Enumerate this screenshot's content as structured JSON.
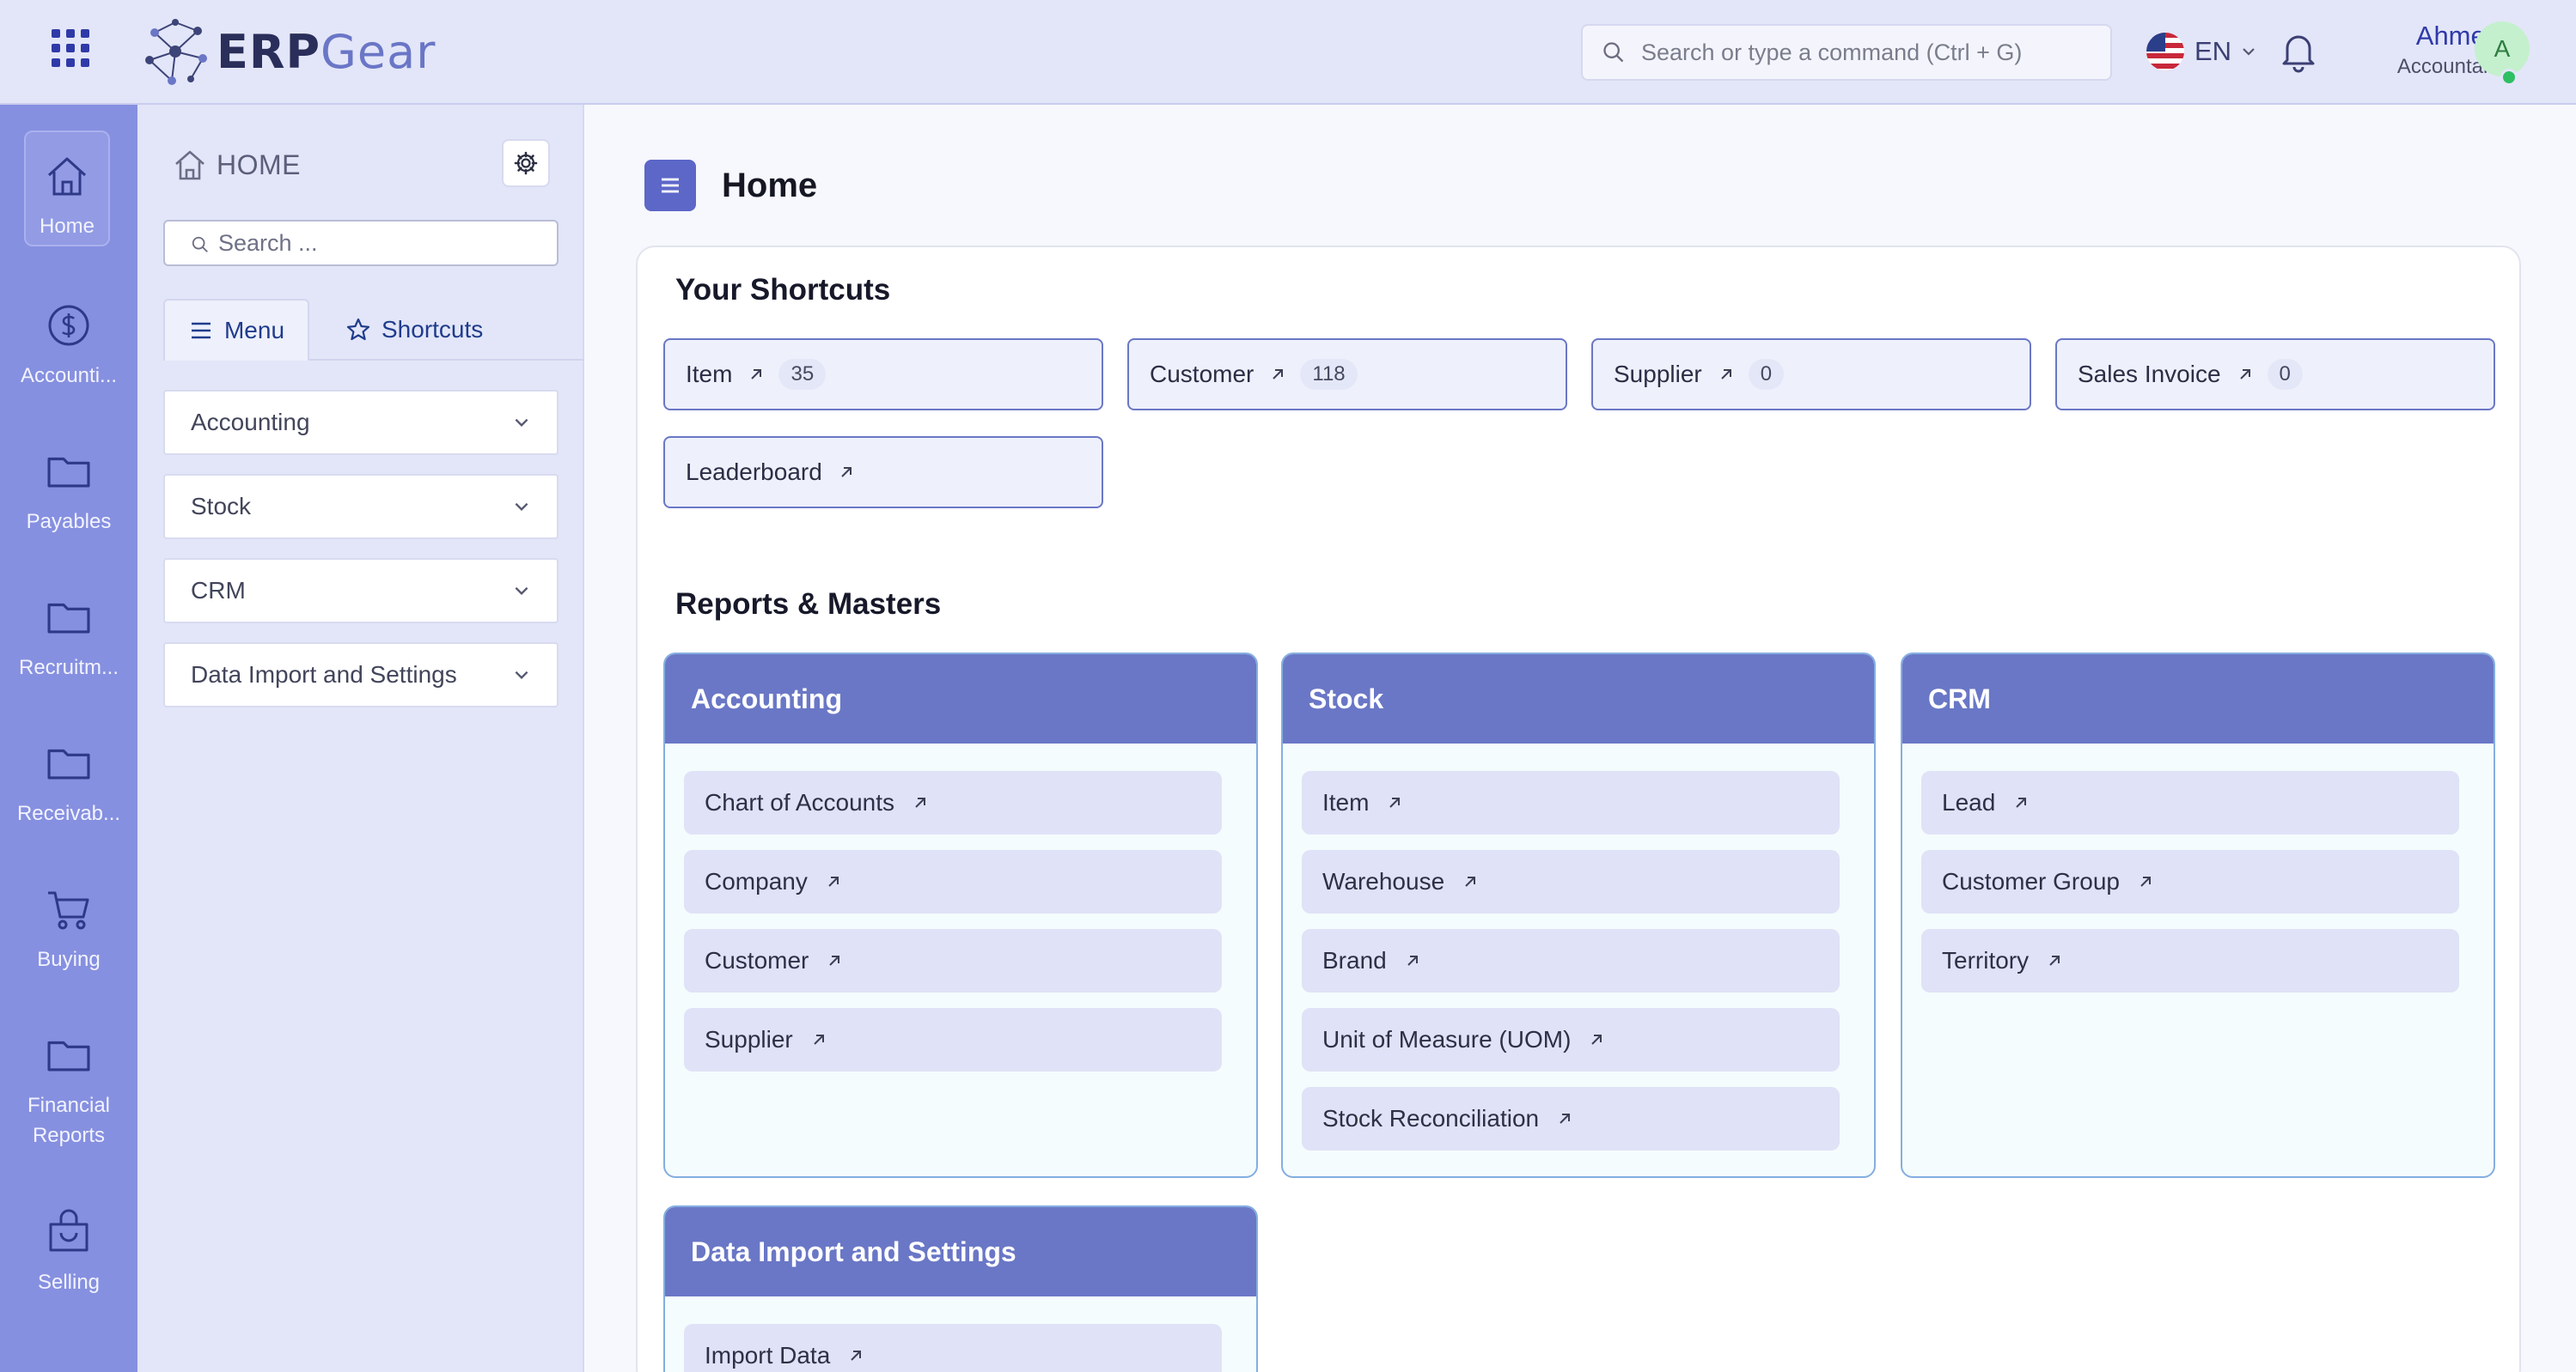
{
  "header": {
    "logo_primary": "ERP",
    "logo_secondary": "Gear",
    "search_placeholder": "Search or type a command (Ctrl + G)",
    "language": "EN",
    "user_name": "Ahmed",
    "user_role": "Accountant",
    "avatar_initial": "A"
  },
  "rail": {
    "items": [
      {
        "label": "Home",
        "icon": "home-icon"
      },
      {
        "label": "Accounti...",
        "icon": "dollar-circle-icon"
      },
      {
        "label": "Payables",
        "icon": "folder-icon"
      },
      {
        "label": "Recruitm...",
        "icon": "folder-icon"
      },
      {
        "label": "Receivab...",
        "icon": "folder-icon"
      },
      {
        "label": "Buying",
        "icon": "cart-icon"
      },
      {
        "label": "Financial Reports",
        "icon": "folder-icon"
      },
      {
        "label": "Selling",
        "icon": "shopping-bag-icon"
      }
    ]
  },
  "panel": {
    "title": "HOME",
    "search_placeholder": "Search ...",
    "tab_menu": "Menu",
    "tab_shortcuts": "Shortcuts",
    "accordion": [
      "Accounting",
      "Stock",
      "CRM",
      "Data Import and Settings"
    ]
  },
  "main": {
    "title": "Home",
    "shortcuts_title": "Your Shortcuts",
    "shortcuts": [
      {
        "label": "Item",
        "count": "35"
      },
      {
        "label": "Customer",
        "count": "118"
      },
      {
        "label": "Supplier",
        "count": "0"
      },
      {
        "label": "Sales Invoice",
        "count": "0"
      },
      {
        "label": "Leaderboard",
        "count": null
      }
    ],
    "reports_title": "Reports & Masters",
    "groups": [
      {
        "title": "Accounting",
        "links": [
          "Chart of Accounts",
          "Company",
          "Customer",
          "Supplier"
        ]
      },
      {
        "title": "Stock",
        "links": [
          "Item",
          "Warehouse",
          "Brand",
          "Unit of Measure (UOM)",
          "Stock Reconciliation"
        ]
      },
      {
        "title": "CRM",
        "links": [
          "Lead",
          "Customer Group",
          "Territory"
        ]
      },
      {
        "title": "Data Import and Settings",
        "links": [
          "Import Data"
        ]
      }
    ]
  },
  "colors": {
    "accent": "#6a77c6",
    "rail": "#8690e0",
    "header_bg": "#e3e6f8",
    "status_online": "#2fbf63"
  }
}
